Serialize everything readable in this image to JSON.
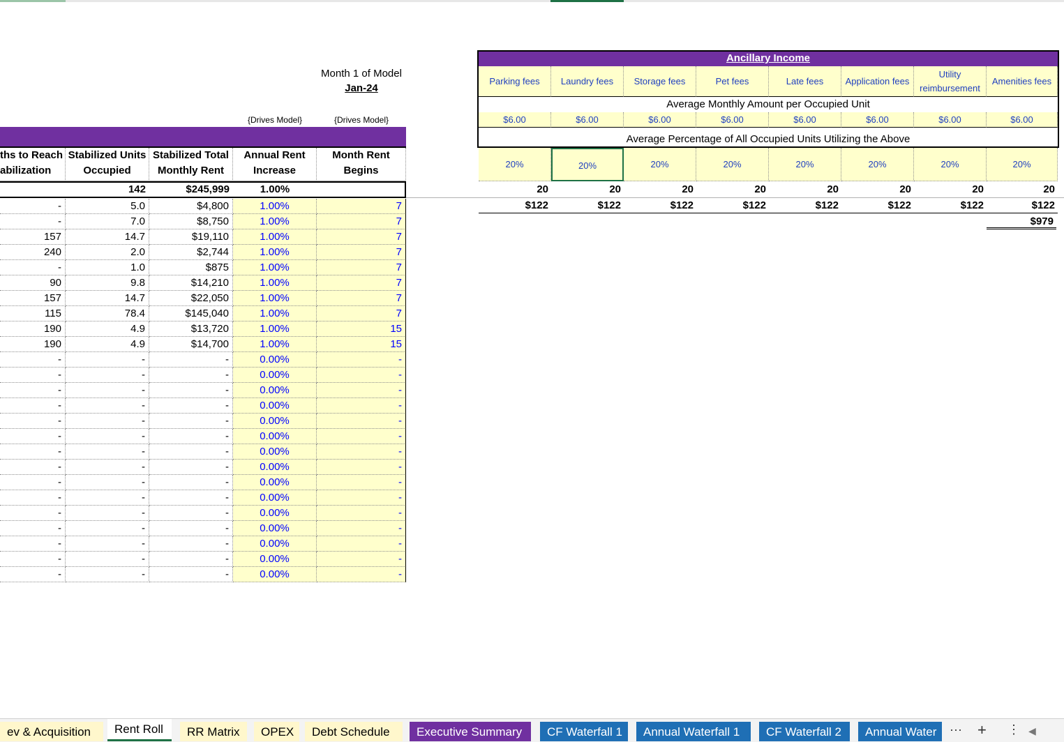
{
  "header": {
    "month_label": "Month 1 of Model",
    "month_value": "Jan-24",
    "drives_model_1": "{Drives Model}",
    "drives_model_2": "{Drives Model}"
  },
  "rent_table": {
    "columns": [
      {
        "line1": "ths to Reach",
        "line2": "abilization"
      },
      {
        "line1": "Stabilized Units",
        "line2": "Occupied"
      },
      {
        "line1": "Stabilized Total",
        "line2": "Monthly Rent"
      },
      {
        "line1": "Annual Rent",
        "line2": "Increase"
      },
      {
        "line1": "Month Rent",
        "line2": "Begins"
      }
    ],
    "totals": [
      "",
      "142",
      "$245,999",
      "1.00%",
      ""
    ],
    "rows": [
      [
        "-",
        "5.0",
        "$4,800",
        "1.00%",
        "7"
      ],
      [
        "-",
        "7.0",
        "$8,750",
        "1.00%",
        "7"
      ],
      [
        "157",
        "14.7",
        "$19,110",
        "1.00%",
        "7"
      ],
      [
        "240",
        "2.0",
        "$2,744",
        "1.00%",
        "7"
      ],
      [
        "-",
        "1.0",
        "$875",
        "1.00%",
        "7"
      ],
      [
        "90",
        "9.8",
        "$14,210",
        "1.00%",
        "7"
      ],
      [
        "157",
        "14.7",
        "$22,050",
        "1.00%",
        "7"
      ],
      [
        "115",
        "78.4",
        "$145,040",
        "1.00%",
        "7"
      ],
      [
        "190",
        "4.9",
        "$13,720",
        "1.00%",
        "15"
      ],
      [
        "190",
        "4.9",
        "$14,700",
        "1.00%",
        "15"
      ],
      [
        "-",
        "-",
        "-",
        "0.00%",
        "-"
      ],
      [
        "-",
        "-",
        "-",
        "0.00%",
        "-"
      ],
      [
        "-",
        "-",
        "-",
        "0.00%",
        "-"
      ],
      [
        "-",
        "-",
        "-",
        "0.00%",
        "-"
      ],
      [
        "-",
        "-",
        "-",
        "0.00%",
        "-"
      ],
      [
        "-",
        "-",
        "-",
        "0.00%",
        "-"
      ],
      [
        "-",
        "-",
        "-",
        "0.00%",
        "-"
      ],
      [
        "-",
        "-",
        "-",
        "0.00%",
        "-"
      ],
      [
        "-",
        "-",
        "-",
        "0.00%",
        "-"
      ],
      [
        "-",
        "-",
        "-",
        "0.00%",
        "-"
      ],
      [
        "-",
        "-",
        "-",
        "0.00%",
        "-"
      ],
      [
        "-",
        "-",
        "-",
        "0.00%",
        "-"
      ],
      [
        "-",
        "-",
        "-",
        "0.00%",
        "-"
      ],
      [
        "-",
        "-",
        "-",
        "0.00%",
        "-"
      ],
      [
        "-",
        "-",
        "-",
        "0.00%",
        "-"
      ]
    ]
  },
  "ancillary": {
    "title": "Ancillary Income",
    "amount_band": "Average Monthly Amount per Occupied Unit",
    "pct_band": "Average Percentage of All Occupied Units Utilizing the Above",
    "columns": [
      {
        "name": "Parking fees",
        "amount": "$6.00",
        "pct": "20%",
        "units": "20",
        "total": "$122"
      },
      {
        "name": "Laundry fees",
        "amount": "$6.00",
        "pct": "20%",
        "units": "20",
        "total": "$122"
      },
      {
        "name": "Storage fees",
        "amount": "$6.00",
        "pct": "20%",
        "units": "20",
        "total": "$122"
      },
      {
        "name": "Pet fees",
        "amount": "$6.00",
        "pct": "20%",
        "units": "20",
        "total": "$122"
      },
      {
        "name": "Late fees",
        "amount": "$6.00",
        "pct": "20%",
        "units": "20",
        "total": "$122"
      },
      {
        "name": "Application fees",
        "amount": "$6.00",
        "pct": "20%",
        "units": "20",
        "total": "$122"
      },
      {
        "name": "Utility reimbursement",
        "amount": "$6.00",
        "pct": "20%",
        "units": "20",
        "total": "$122"
      },
      {
        "name": "Amenities fees",
        "amount": "$6.00",
        "pct": "20%",
        "units": "20",
        "total": "$122"
      }
    ],
    "grand_total": "$979"
  },
  "tabs": [
    {
      "label": "ev & Acquisition",
      "style": "plain"
    },
    {
      "label": "Rent Roll",
      "style": "active"
    },
    {
      "label": "RR Matrix",
      "style": "plain"
    },
    {
      "label": "OPEX",
      "style": "plain"
    },
    {
      "label": "Debt Schedule",
      "style": "plain"
    },
    {
      "label": "Executive Summary",
      "style": "purple"
    },
    {
      "label": "CF Waterfall 1",
      "style": "blue"
    },
    {
      "label": "Annual Waterfall 1",
      "style": "blue"
    },
    {
      "label": "CF Waterfall 2",
      "style": "blue"
    },
    {
      "label": "Annual Water",
      "style": "blue"
    }
  ],
  "tab_controls": {
    "more": "···",
    "add": "+",
    "options": "⋮",
    "scroll_left": "◀"
  },
  "colors": {
    "accent_purple": "#7030a0",
    "input_yellow": "#ffffcc",
    "input_blue": "#0000ff",
    "tab_blue": "#1f6fb5",
    "active_green": "#1e7145"
  }
}
